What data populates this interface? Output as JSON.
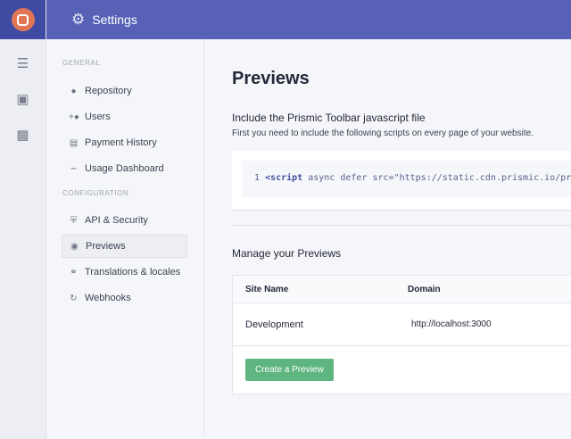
{
  "header": {
    "title": "Settings",
    "icon": "gear-icon"
  },
  "rail": {
    "icons": [
      "list-icon",
      "image-icon",
      "clipboard-download-icon"
    ]
  },
  "sidebar": {
    "sections": [
      {
        "label": "GENERAL",
        "items": [
          {
            "label": "Repository",
            "icon": "globe-icon"
          },
          {
            "label": "Users",
            "icon": "add-user-icon"
          },
          {
            "label": "Payment History",
            "icon": "credit-card-icon"
          },
          {
            "label": "Usage Dashboard",
            "icon": "chart-line-icon"
          }
        ]
      },
      {
        "label": "CONFIGURATION",
        "items": [
          {
            "label": "API & Security",
            "icon": "shield-icon"
          },
          {
            "label": "Previews",
            "icon": "eye-icon",
            "active": true
          },
          {
            "label": "Translations & locales",
            "icon": "globe-icon"
          },
          {
            "label": "Webhooks",
            "icon": "sync-icon"
          }
        ]
      }
    ]
  },
  "main": {
    "title": "Previews",
    "toolbar_heading": "Include the Prismic Toolbar javascript file",
    "toolbar_sub": "First you need to include the following scripts on every page of your website.",
    "code": {
      "line": "1",
      "tag": "<script",
      "rest": " async defer src=\"https://static.cdn.prismic.io/pri"
    },
    "manage_heading": "Manage your Previews",
    "table": {
      "headers": [
        "Site Name",
        "Domain"
      ],
      "rows": [
        [
          "Development",
          "http://localhost:3000"
        ]
      ]
    },
    "create_button": "Create a Preview"
  }
}
